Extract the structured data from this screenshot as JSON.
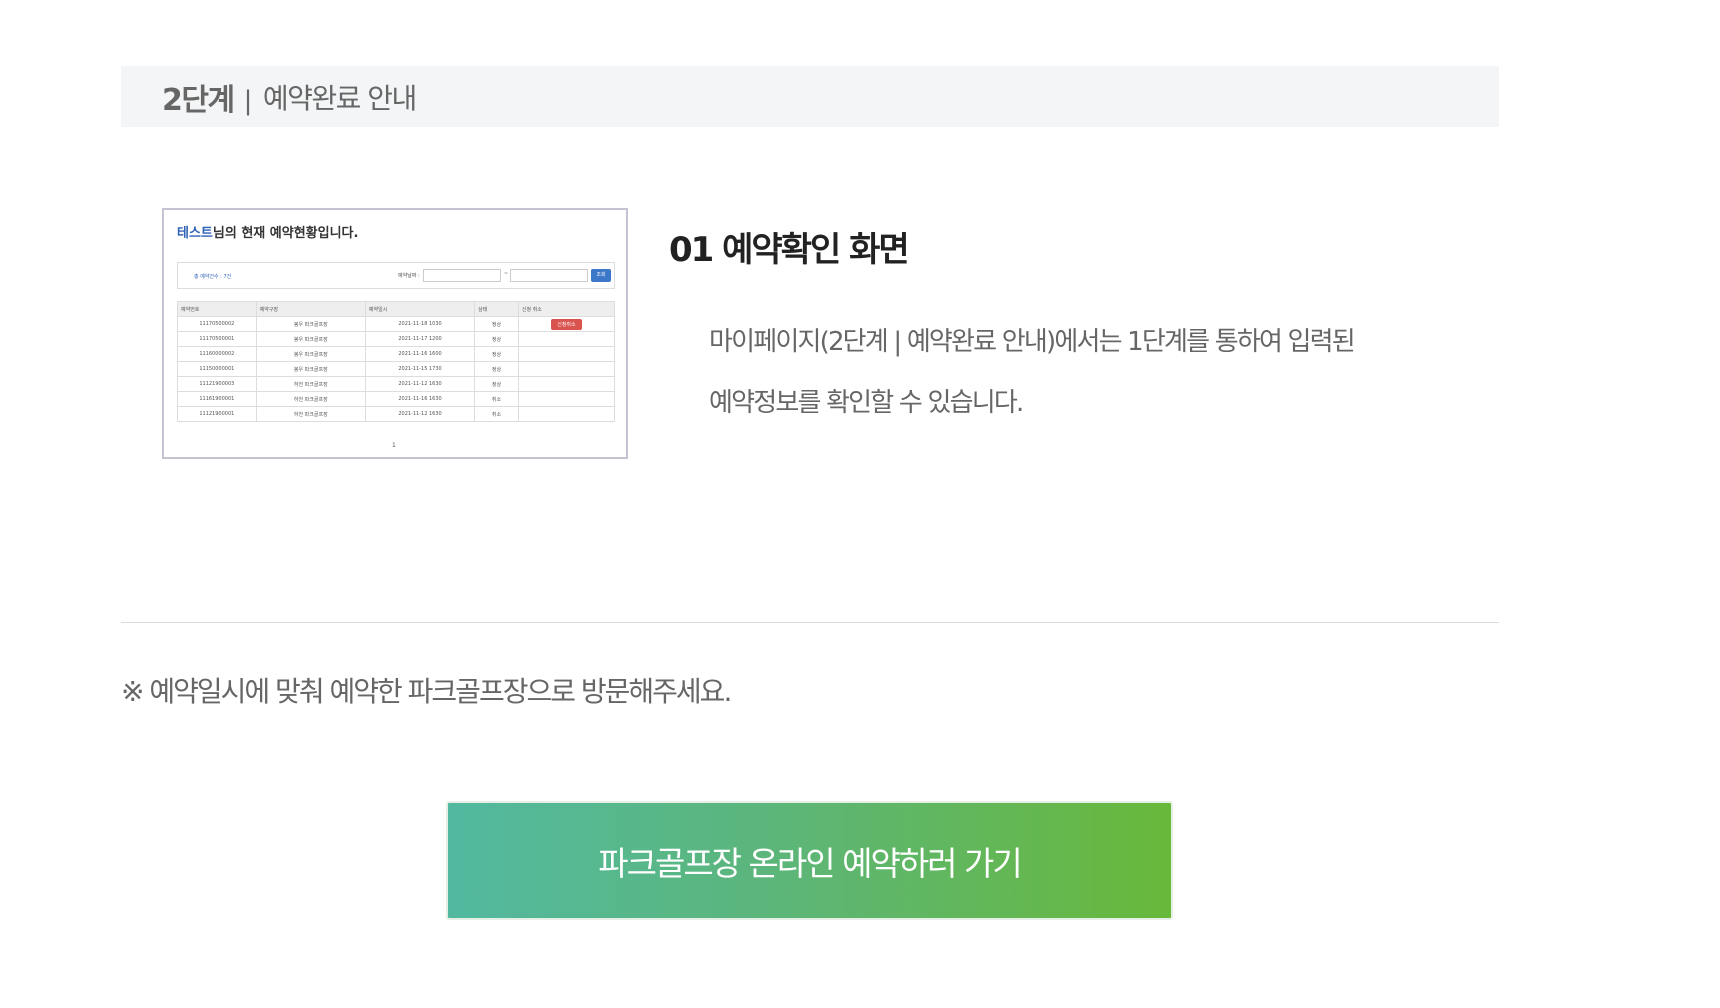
{
  "step": {
    "number": "2단계",
    "separator": "|",
    "title": "예약완료 안내"
  },
  "thumbnail": {
    "title_name": "테스트",
    "title_rest": "님의 현재 예약현황입니다.",
    "filter": {
      "count": "총 예약건수 : 7건",
      "date_label": "예약날짜 :",
      "dash": "~",
      "button": "조회"
    },
    "table": {
      "headers": [
        "예약번호",
        "예약구장",
        "예약일시",
        "상태",
        "신청 취소"
      ],
      "rows": [
        [
          "11170500002",
          "봉우 파크골프장",
          "2021-11-18 1030",
          "정상",
          "신청취소"
        ],
        [
          "11170500001",
          "봉우 파크골프장",
          "2021-11-17 1200",
          "정상",
          ""
        ],
        [
          "11160000002",
          "봉우 파크골프장",
          "2021-11-16 1600",
          "정상",
          ""
        ],
        [
          "11150000001",
          "봉우 파크골프장",
          "2021-11-15 1730",
          "정상",
          ""
        ],
        [
          "11121900003",
          "하천 파크골프장",
          "2021-11-12 1630",
          "정상",
          ""
        ],
        [
          "11161900001",
          "하천 파크골프장",
          "2021-11-16 1630",
          "취소",
          ""
        ],
        [
          "11121900001",
          "하천 파크골프장",
          "2021-11-12 1630",
          "취소",
          ""
        ]
      ]
    },
    "page": "1"
  },
  "section": {
    "title": "01 예약확인 화면",
    "desc_line1": "마이페이지(2단계 | 예약완료 안내)에서는 1단계를 통하여 입력된",
    "desc_line2": "예약정보를 확인할 수 있습니다."
  },
  "notice": "※ 예약일시에 맞춰 예약한 파크골프장으로 방문해주세요.",
  "cta": {
    "label": "파크골프장 온라인 예약하러 가기"
  },
  "colors": {
    "cta_gradient_start": "#52b9a0",
    "cta_gradient_end": "#68b83a",
    "step_bar_bg": "#f4f5f6",
    "name_highlight": "#2f62b7",
    "cancel_button": "#d9534f"
  }
}
